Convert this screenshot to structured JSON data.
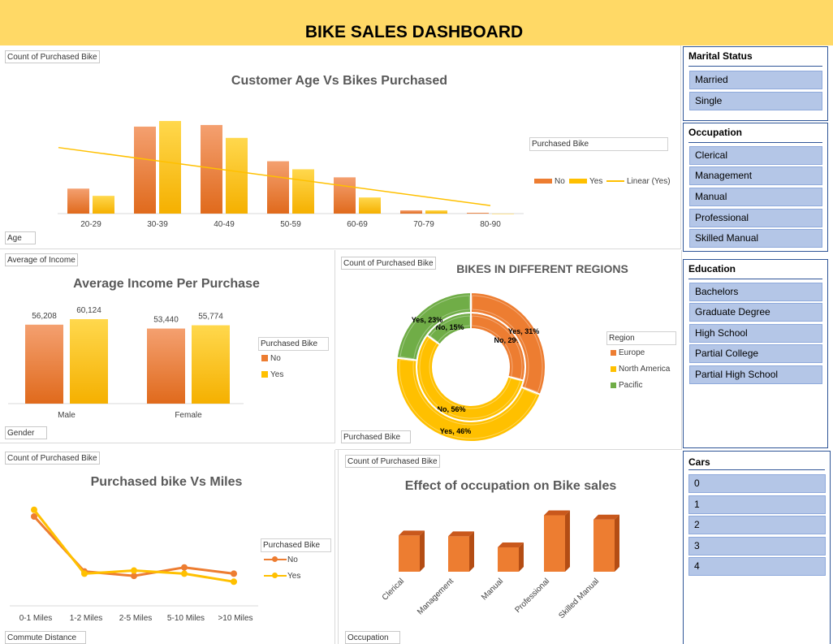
{
  "dashboard_title": "BIKE SALES DASHBOARD",
  "colors": {
    "no": "#ed7d31",
    "yes": "#ffc000",
    "pacific": "#70ad47",
    "banner": "#ffd966",
    "slicer_fill": "#b4c6e7",
    "slicer_border": "#2f5597"
  },
  "age_chart": {
    "field_button": "Count of Purchased Bike",
    "axis_button": "Age",
    "legend_title": "Purchased Bike",
    "legend": {
      "no": "No",
      "yes": "Yes",
      "trend": "Linear (Yes)"
    }
  },
  "income_chart": {
    "field_button": "Average of Income",
    "axis_button": "Gender",
    "legend_title": "Purchased Bike",
    "legend": {
      "no": "No",
      "yes": "Yes"
    }
  },
  "region_chart": {
    "field_button": "Count of Purchased Bike",
    "axis_button": "Purchased Bike",
    "legend_title": "Region",
    "legend": {
      "europe": "Europe",
      "north_america": "North America",
      "pacific": "Pacific"
    }
  },
  "miles_chart": {
    "field_button": "Count of Purchased Bike",
    "axis_button": "Commute Distance",
    "legend_title": "Purchased Bike",
    "legend": {
      "no": "No",
      "yes": "Yes"
    }
  },
  "occupation_chart": {
    "field_button": "Count of Purchased Bike",
    "axis_button": "Occupation"
  },
  "chart_data": [
    {
      "type": "bar",
      "title": "Customer Age Vs Bikes Purchased",
      "categories": [
        "20-29",
        "30-39",
        "40-49",
        "50-59",
        "60-69",
        "70-79",
        "80-90"
      ],
      "series": [
        {
          "name": "No",
          "values": [
            31,
            108,
            110,
            65,
            45,
            4,
            1
          ]
        },
        {
          "name": "Yes",
          "values": [
            22,
            115,
            94,
            55,
            20,
            4,
            0
          ]
        }
      ],
      "trendline": {
        "name": "Linear (Yes)",
        "series": "Yes",
        "start": 82,
        "end": 10
      },
      "ylim": [
        0,
        120
      ],
      "legend_position": "right"
    },
    {
      "type": "bar",
      "title": "Average Income Per Purchase",
      "categories": [
        "Male",
        "Female"
      ],
      "series": [
        {
          "name": "No",
          "values": [
            56208,
            53440
          ],
          "labels": [
            "56,208",
            "53,440"
          ]
        },
        {
          "name": "Yes",
          "values": [
            60124,
            55774
          ],
          "labels": [
            "60,124",
            "55,774"
          ]
        }
      ],
      "ylim": [
        0,
        70000
      ],
      "legend_position": "right"
    },
    {
      "type": "pie",
      "title": "BIKES IN DIFFERENT REGIONS",
      "rings": [
        {
          "name": "No",
          "slices": [
            {
              "region": "Europe",
              "value": 29,
              "label": "No, 29%"
            },
            {
              "region": "North America",
              "value": 56,
              "label": "No, 56%"
            },
            {
              "region": "Pacific",
              "value": 15,
              "label": "No, 15%"
            }
          ]
        },
        {
          "name": "Yes",
          "slices": [
            {
              "region": "Europe",
              "value": 31,
              "label": "Yes, 31%"
            },
            {
              "region": "North America",
              "value": 46,
              "label": "Yes, 46%"
            },
            {
              "region": "Pacific",
              "value": 23,
              "label": "Yes, 23%"
            }
          ]
        }
      ],
      "legend_position": "right"
    },
    {
      "type": "line",
      "title": "Purchased bike Vs Miles",
      "categories": [
        "0-1 Miles",
        "1-2 Miles",
        "2-5 Miles",
        "5-10 Miles",
        ">10  Miles"
      ],
      "series": [
        {
          "name": "No",
          "values": [
            200,
            77,
            67,
            86,
            72
          ]
        },
        {
          "name": "Yes",
          "values": [
            215,
            72,
            79,
            72,
            54
          ]
        }
      ],
      "ylim": [
        0,
        240
      ],
      "legend_position": "right"
    },
    {
      "type": "bar",
      "title": "Effect of occupation on Bike sales",
      "categories": [
        "Clerical",
        "Management",
        "Manual",
        "Professional",
        "Skilled Manual"
      ],
      "series": [
        {
          "values": [
            177,
            173,
            119,
            276,
            255
          ]
        }
      ],
      "ylim": [
        0,
        300
      ]
    }
  ],
  "slicers": [
    {
      "title": "Marital Status",
      "items": [
        "Married",
        "Single"
      ]
    },
    {
      "title": "Occupation",
      "items": [
        "Clerical",
        "Management",
        "Manual",
        "Professional",
        "Skilled Manual"
      ]
    },
    {
      "title": "Education",
      "items": [
        "Bachelors",
        "Graduate Degree",
        "High School",
        "Partial College",
        "Partial High School"
      ]
    },
    {
      "title": "Cars",
      "items": [
        "0",
        "1",
        "2",
        "3",
        "4"
      ]
    }
  ]
}
